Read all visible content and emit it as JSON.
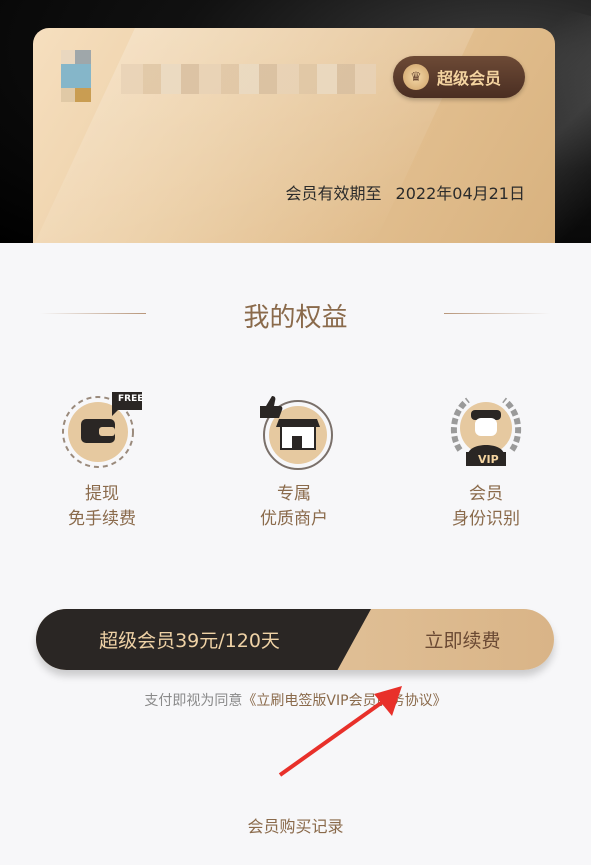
{
  "card": {
    "badge_label": "超级会员",
    "expiry_label": "会员有效期至",
    "expiry_date": "2022年04月21日"
  },
  "benefits": {
    "title": "我的权益",
    "items": [
      {
        "line1": "提现",
        "line2": "免手续费",
        "icon": "wallet-free-icon",
        "tag": "FREE"
      },
      {
        "line1": "专属",
        "line2": "优质商户",
        "icon": "storefront-thumbs-up-icon"
      },
      {
        "line1": "会员",
        "line2": "身份识别",
        "icon": "vip-laurel-avatar-icon",
        "tag": "VIP"
      }
    ]
  },
  "purchase": {
    "plan_label": "超级会员39元/120天",
    "action_label": "立即续费",
    "agreement_prefix": "支付即视为同意",
    "agreement_link": "《立刷电签版VIP会员服务协议》"
  },
  "records_link": "会员购买记录",
  "colors": {
    "gold_text": "#8a6a4b",
    "dark_bar": "#2a2624",
    "accent_arrow": "#e8302a"
  }
}
